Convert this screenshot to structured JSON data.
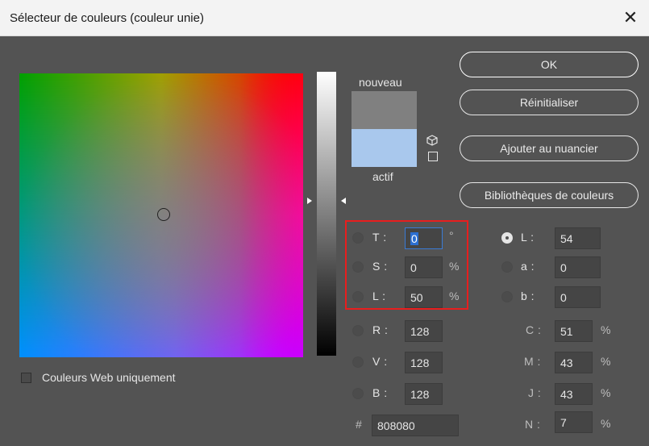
{
  "window": {
    "title": "Sélecteur de couleurs (couleur unie)",
    "close_glyph": "✕"
  },
  "swatches": {
    "new_label": "nouveau",
    "current_label": "actif",
    "new_color": "#808080",
    "current_color": "#a9c8ed"
  },
  "buttons": {
    "ok": "OK",
    "reset": "Réinitialiser",
    "add_to_swatches": "Ajouter au nuancier",
    "color_libraries": "Bibliothèques de couleurs"
  },
  "hsl": [
    {
      "key": "T",
      "label": "T :",
      "value": "0",
      "unit": "°",
      "checked": false
    },
    {
      "key": "S",
      "label": "S :",
      "value": "0",
      "unit": "%",
      "checked": false
    },
    {
      "key": "L",
      "label": "L :",
      "value": "50",
      "unit": "%",
      "checked": false
    }
  ],
  "rgb": [
    {
      "key": "R",
      "label": "R :",
      "value": "128"
    },
    {
      "key": "V",
      "label": "V :",
      "value": "128"
    },
    {
      "key": "B",
      "label": "B :",
      "value": "128"
    }
  ],
  "lab": [
    {
      "key": "L",
      "label": "L :",
      "value": "54",
      "checked": true
    },
    {
      "key": "a",
      "label": "a :",
      "value": "0",
      "checked": false
    },
    {
      "key": "b",
      "label": "b :",
      "value": "0",
      "checked": false
    }
  ],
  "cmjn": [
    {
      "key": "C",
      "label": "C :",
      "value": "51",
      "unit": "%"
    },
    {
      "key": "M",
      "label": "M :",
      "value": "43",
      "unit": "%"
    },
    {
      "key": "J",
      "label": "J :",
      "value": "43",
      "unit": "%"
    },
    {
      "key": "N",
      "label": "N :",
      "value": "7",
      "unit": "%"
    }
  ],
  "hex": {
    "label": "#",
    "value": "808080"
  },
  "web_only": {
    "label": "Couleurs Web uniquement",
    "checked": false
  },
  "icons": {
    "cube": "gamut-cube-icon",
    "websafe": "websafe-square-icon",
    "close": "close-icon"
  }
}
